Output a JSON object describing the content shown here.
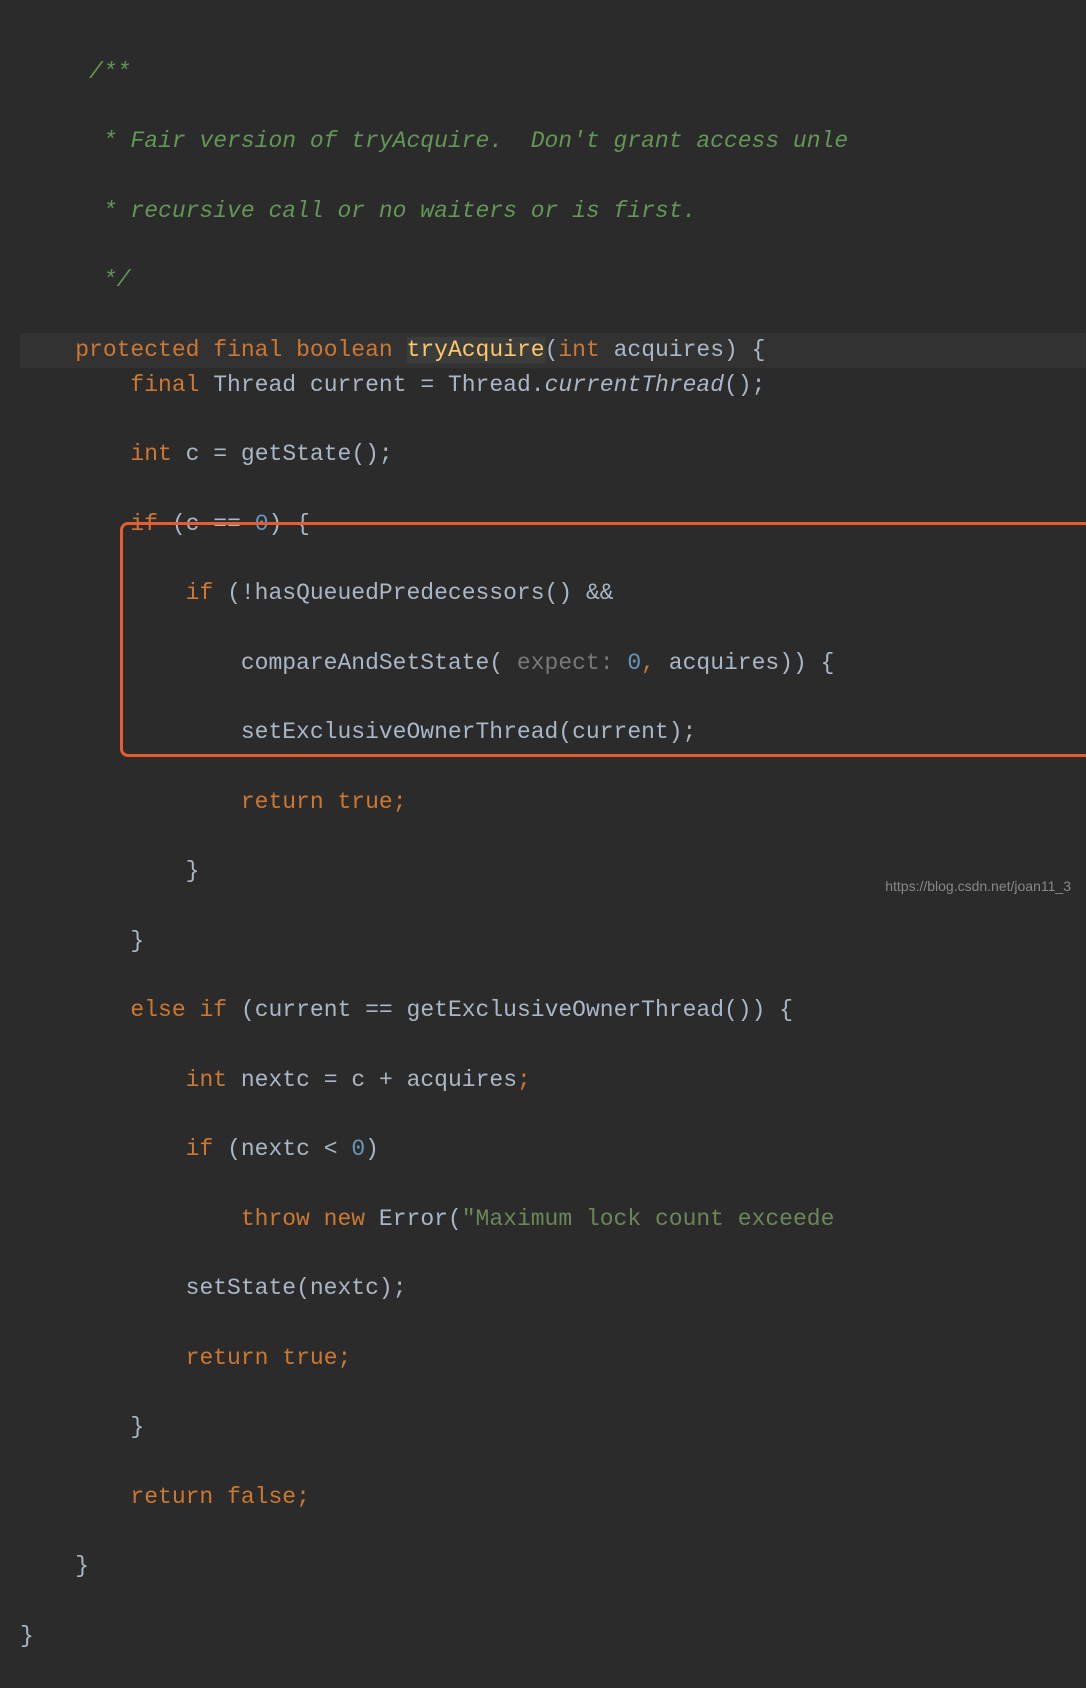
{
  "code": {
    "comment1": "/**",
    "comment2": " * Fair version of tryAcquire.  Don't grant access unle",
    "comment3": " * recursive call or no waiters or is first.",
    "comment4": " */",
    "kw_protected": "protected",
    "kw_final": "final",
    "kw_boolean": "boolean",
    "method_tryAcquire": "tryAcquire",
    "kw_int": "int",
    "param_acquires": "acquires",
    "kw_final2": "final",
    "type_Thread": "Thread",
    "var_current": "current",
    "type_Thread2": "Thread",
    "method_currentThread": "currentThread",
    "kw_int2": "int",
    "var_c": "c",
    "method_getState": "getState",
    "kw_if": "if",
    "var_c2": "c",
    "num_0": "0",
    "kw_if2": "if",
    "method_hasQueuedPredecessors": "hasQueuedPredecessors",
    "method_compareAndSetState": "compareAndSetState",
    "hint_expect": "expect:",
    "num_0_2": "0",
    "var_acquires2": "acquires",
    "method_setExclusiveOwnerThread": "setExclusiveOwnerThread",
    "var_current2": "current",
    "kw_return": "return",
    "kw_true": "true",
    "kw_else": "else",
    "kw_if3": "if",
    "var_current3": "current",
    "method_getExclusiveOwnerThread": "getExclusiveOwnerThread",
    "kw_int3": "int",
    "var_nextc": "nextc",
    "var_c3": "c",
    "var_acquires3": "acquires",
    "kw_if4": "if",
    "var_nextc2": "nextc",
    "num_0_3": "0",
    "kw_throw": "throw",
    "kw_new": "new",
    "type_Error": "Error",
    "str_error": "\"Maximum lock count exceede",
    "method_setState": "setState",
    "var_nextc3": "nextc",
    "kw_return2": "return",
    "kw_true2": "true",
    "kw_return3": "return",
    "kw_false": "false"
  },
  "watermark": "https://blog.csdn.net/joan11_3"
}
